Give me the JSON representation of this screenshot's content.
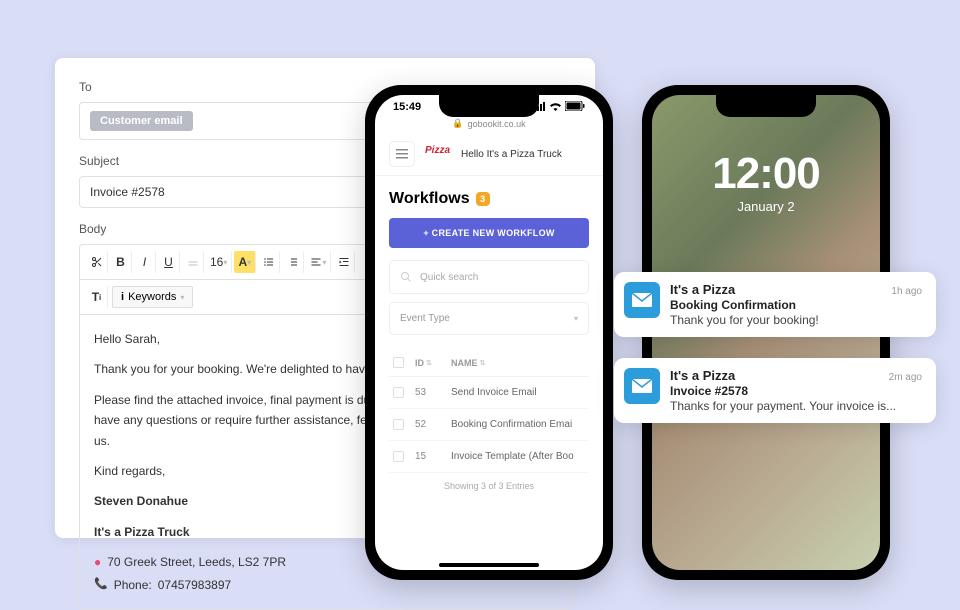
{
  "compose": {
    "to_label": "To",
    "to_pill": "Customer email",
    "subject_label": "Subject",
    "subject_value": "Invoice #2578",
    "body_label": "Body",
    "toolbar": {
      "font_size": "16",
      "keywords_label": "Keywords"
    },
    "body": {
      "greeting": "Hello Sarah,",
      "p1": "Thank you for your booking. We're delighted to have y",
      "p2": "Please find the attached invoice, final payment is due",
      "p3": "have any questions or require further assistance, feel",
      "p4": "us.",
      "closing": "Kind regards,",
      "signature_name": "Steven Donahue",
      "signature_business": "It's a Pizza Truck",
      "signature_address": "70 Greek Street, Leeds, LS2 7PR",
      "signature_phone_label": "Phone:",
      "signature_phone": "07457983897"
    }
  },
  "phone1": {
    "time": "15:49",
    "url": "gobookit.co.uk",
    "greeting": "Hello It's a Pizza Truck",
    "workflows_title": "Workflows",
    "workflows_count": "3",
    "create_btn": "+ CREATE NEW WORKFLOW",
    "search_placeholder": "Quick search",
    "event_type": "Event Type",
    "th_id": "ID",
    "th_name": "NAME",
    "rows": [
      {
        "id": "53",
        "name": "Send Invoice Email"
      },
      {
        "id": "52",
        "name": "Booking Confirmation Emai"
      },
      {
        "id": "15",
        "name": "Invoice Template (After Boo"
      }
    ],
    "showing": "Showing 3 of 3 Entries"
  },
  "phone2": {
    "clock": "12:00",
    "date": "January 2"
  },
  "notifications": [
    {
      "app": "It's a Pizza",
      "time": "1h ago",
      "title": "Booking Confirmation",
      "msg": "Thank you for your booking!"
    },
    {
      "app": "It's a Pizza",
      "time": "2m ago",
      "title": "Invoice #2578",
      "msg": "Thanks for your payment. Your invoice is..."
    }
  ]
}
